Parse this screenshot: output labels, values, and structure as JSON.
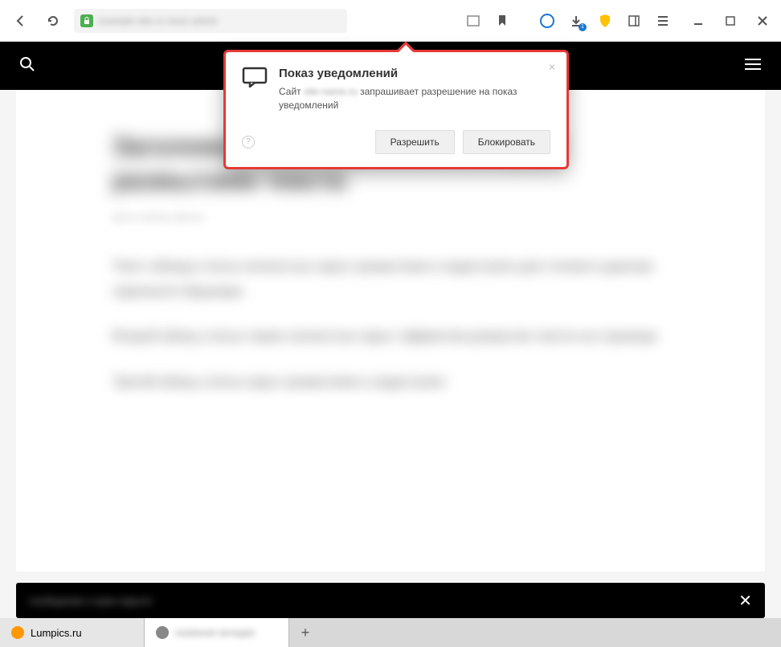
{
  "browser": {
    "url_obscured": "example-site.ru news article",
    "downloads_count": "1"
  },
  "notification_dialog": {
    "title": "Показ уведомлений",
    "body_prefix": "Сайт",
    "site_obscured": "site-name.ru",
    "body_suffix": "запрашивает разрешение на показ уведомлений",
    "allow_label": "Разрешить",
    "block_label": "Блокировать",
    "help_label": "?",
    "close_label": "×"
  },
  "page": {
    "title_blur": "Заголовок новостной статьи скрыт размытием текста",
    "meta_blur": "дата и автор скрыты",
    "para1": "Текст абзаца статьи полностью скрыт размытием и недоступен для чтения в данном скриншоте браузера",
    "para2": "Второй абзац статьи также полностью скрыт эффектом размытия текста на странице",
    "para3": "Третий абзац статьи скрыт размытием и недоступен",
    "cookie_blur": "сообщение о куки скрыто"
  },
  "tabs": {
    "tab1_label": "Lumpics.ru",
    "tab2_blur": "название вкладки",
    "new_tab": "+"
  }
}
